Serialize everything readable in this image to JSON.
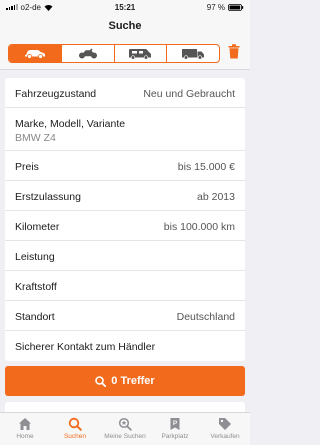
{
  "status_bar": {
    "carrier": "o2-de",
    "time": "15:21",
    "battery_percent": "97 %",
    "battery_level": 0.97
  },
  "header": {
    "title": "Suche"
  },
  "vehicle_types": [
    {
      "icon": "car-icon",
      "selected": true
    },
    {
      "icon": "motorcycle-icon",
      "selected": false
    },
    {
      "icon": "motorhome-icon",
      "selected": false
    },
    {
      "icon": "truck-icon",
      "selected": false
    }
  ],
  "filters": {
    "condition": {
      "label": "Fahrzeugzustand",
      "value": "Neu und Gebraucht"
    },
    "make_model": {
      "label": "Marke, Modell, Variante",
      "value": "BMW Z4"
    },
    "price": {
      "label": "Preis",
      "value": "bis 15.000 €"
    },
    "registration": {
      "label": "Erstzulassung",
      "value": "ab 2013"
    },
    "mileage": {
      "label": "Kilometer",
      "value": "bis 100.000 km"
    },
    "power": {
      "label": "Leistung",
      "value": ""
    },
    "fuel": {
      "label": "Kraftstoff",
      "value": ""
    },
    "location": {
      "label": "Standort",
      "value": "Deutschland"
    },
    "secure_contact": {
      "label": "Sicherer Kontakt zum Händler",
      "value": ""
    }
  },
  "search_button": {
    "label": "0 Treffer"
  },
  "tabs": [
    {
      "label": "Home",
      "icon": "home-icon",
      "active": false
    },
    {
      "label": "Suchen",
      "icon": "search-icon",
      "active": true
    },
    {
      "label": "Meine Suchen",
      "icon": "saved-search-icon",
      "active": false
    },
    {
      "label": "Parkplatz",
      "icon": "parking-icon",
      "active": false
    },
    {
      "label": "Verkaufen",
      "icon": "sell-tag-icon",
      "active": false
    }
  ],
  "colors": {
    "accent": "#f26b1d",
    "inactive": "#8e8e93"
  }
}
